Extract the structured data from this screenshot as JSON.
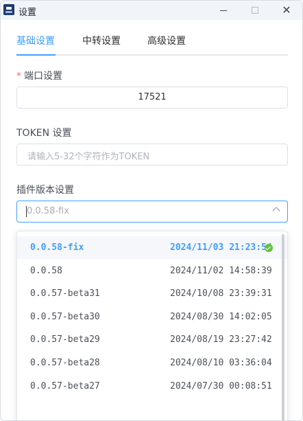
{
  "window": {
    "title": "设置",
    "close_symbol": "✕"
  },
  "tabs": [
    {
      "label": "基础设置",
      "active": true
    },
    {
      "label": "中转设置",
      "active": false
    },
    {
      "label": "高级设置",
      "active": false
    }
  ],
  "port": {
    "required_mark": "*",
    "label": "端口设置",
    "value": "17521"
  },
  "token": {
    "label": "TOKEN 设置",
    "placeholder": "请输入5-32个字符作为TOKEN"
  },
  "plugin_version": {
    "label": "插件版本设置",
    "placeholder": "0.0.58-fix",
    "options": [
      {
        "version": "0.0.58-fix",
        "datetime": "2024/11/03 21:23:54",
        "selected": true
      },
      {
        "version": "0.0.58",
        "datetime": "2024/11/02 14:58:39",
        "selected": false
      },
      {
        "version": "0.0.57-beta31",
        "datetime": "2024/10/08 23:39:31",
        "selected": false
      },
      {
        "version": "0.0.57-beta30",
        "datetime": "2024/08/30 14:02:05",
        "selected": false
      },
      {
        "version": "0.0.57-beta29",
        "datetime": "2024/08/19 23:27:42",
        "selected": false
      },
      {
        "version": "0.0.57-beta28",
        "datetime": "2024/08/10 03:36:04",
        "selected": false
      },
      {
        "version": "0.0.57-beta27",
        "datetime": "2024/07/30 00:08:51",
        "selected": false
      }
    ]
  },
  "colors": {
    "accent": "#409eff",
    "required": "#f56c6c",
    "success": "#67c23a"
  }
}
